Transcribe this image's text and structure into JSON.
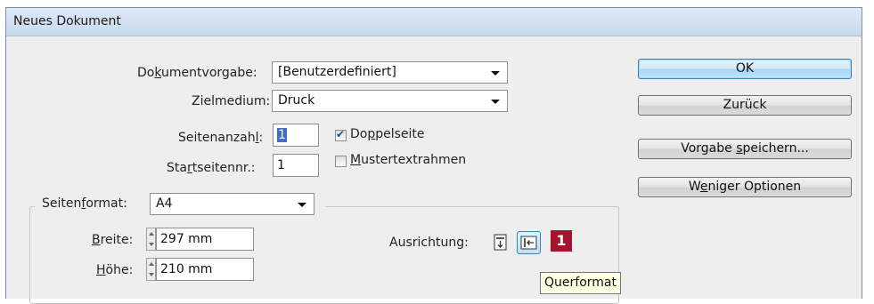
{
  "window": {
    "title": "Neues Dokument"
  },
  "document_preset": {
    "label": "Dokumentvorgabe:",
    "value": "[Benutzerdefiniert]"
  },
  "intent": {
    "label": "Zielmedium:",
    "value": "Druck"
  },
  "pages": {
    "label": "Seitenanzahl:",
    "value": "1"
  },
  "start_page": {
    "label": "Startseitennr.:",
    "value": "1"
  },
  "facing_pages": {
    "label": "Doppelseite",
    "checked": true
  },
  "master_text_frame": {
    "label": "Mustertextrahmen",
    "checked": false
  },
  "page_size": {
    "label": "Seitenformat:",
    "value": "A4"
  },
  "width": {
    "label": "Breite:",
    "value": "297 mm"
  },
  "height": {
    "label": "Höhe:",
    "value": "210 mm"
  },
  "orientation": {
    "label": "Ausrichtung:",
    "selected": "Querformat"
  },
  "buttons": {
    "ok": "OK",
    "back": "Zurück",
    "save_preset": "Vorgabe speichern...",
    "fewer_options": "Weniger Optionen"
  },
  "badge": "1",
  "tooltip": "Querformat",
  "colors": {
    "accent_badge": "#a3152e",
    "titlebar": "#c9d9ee",
    "default_button": "#cfe9fb"
  }
}
